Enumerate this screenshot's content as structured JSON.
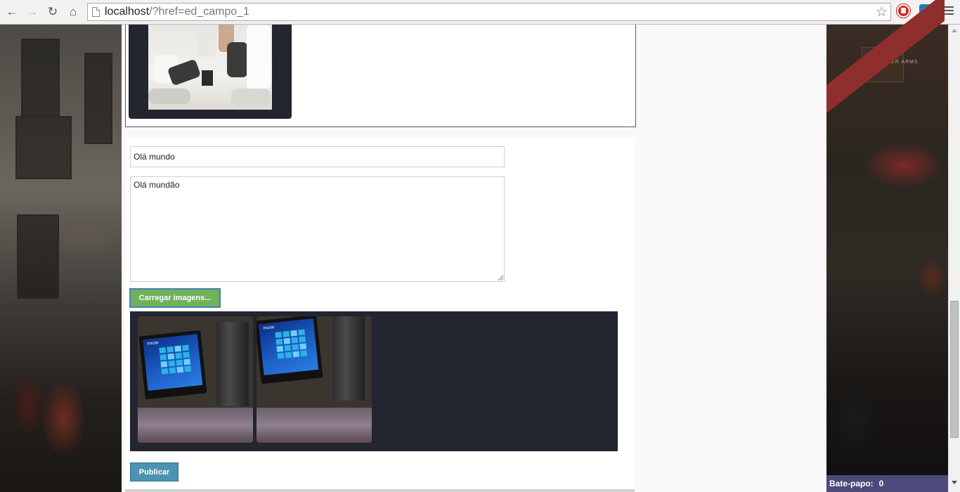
{
  "browser": {
    "url_host": "localhost",
    "url_rest": "/?href=ed_campo_1",
    "icons": {
      "back": "back-arrow-icon",
      "forward": "forward-arrow-icon",
      "reload": "reload-icon",
      "home": "home-icon",
      "bookmark": "star-icon",
      "extension_1": "adblock-icon",
      "extension_2": "extension-icon",
      "menu": "hamburger-menu-icon"
    }
  },
  "post_card": {
    "image_alt": "group meeting photo"
  },
  "form": {
    "title_value": "Olá mundo",
    "body_value": "Olá mundão",
    "upload_label": "Carregar imagens...",
    "gallery_labels": [
      "Iniciar",
      "Iniciar"
    ],
    "publish_label": "Publicar"
  },
  "background": {
    "right_sign_text": "LEICESTER ARMS"
  },
  "chat": {
    "label": "Bate-papo:",
    "count": "0"
  },
  "colors": {
    "upload_button": "#6fb25b",
    "publish_button": "#4c93b2",
    "gallery_bg": "#232530",
    "chat_bar": "#4b4a7a"
  }
}
